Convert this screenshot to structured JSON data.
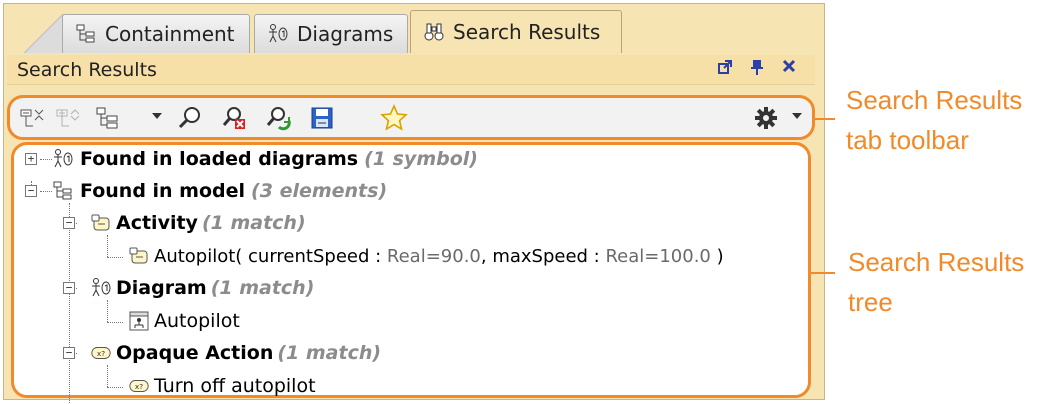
{
  "tabs": [
    {
      "label": "Containment",
      "icon": "containment-tree-icon"
    },
    {
      "label": "Diagrams",
      "icon": "diagrams-icon"
    },
    {
      "label": "Search Results",
      "icon": "binoculars-icon",
      "active": true
    }
  ],
  "panel": {
    "title": "Search Results",
    "controls": [
      "float-icon",
      "pin-icon",
      "close-icon"
    ]
  },
  "toolbar": {
    "buttons": [
      "collapse-all-icon",
      "expand-all-icon",
      "tree-layout-icon",
      "dropdown-arrow-icon",
      "find-icon",
      "clear-search-icon",
      "refresh-search-icon",
      "save-results-icon",
      "favorite-star-icon"
    ],
    "right": [
      "gear-icon",
      "dropdown-arrow-icon"
    ]
  },
  "tree": {
    "nodes": [
      {
        "label": "Found in loaded diagrams",
        "count": "(1 symbol)",
        "icon": "diagrams-icon",
        "expanded": false
      },
      {
        "label": "Found in model",
        "count": "(3 elements)",
        "icon": "containment-tree-icon",
        "expanded": true
      },
      {
        "label": "Activity",
        "count": "(1 match)",
        "icon": "activity-icon",
        "expanded": true
      },
      {
        "label": "Autopilot( currentSpeed : ",
        "val1": "Real=90.0",
        "mid": ", maxSpeed : ",
        "val2": "Real=100.0",
        "end": " )",
        "icon": "activity-icon"
      },
      {
        "label": "Diagram",
        "count": "(1 match)",
        "icon": "diagrams-icon",
        "expanded": true
      },
      {
        "label": "Autopilot",
        "icon": "activity-diagram-icon"
      },
      {
        "label": "Opaque Action",
        "count": "(1 match)",
        "icon": "opaque-action-icon",
        "expanded": true
      },
      {
        "label": "Turn off autopilot",
        "icon": "opaque-action-icon"
      }
    ]
  },
  "annotations": {
    "toolbar": [
      "Search Results",
      "tab toolbar"
    ],
    "tree": [
      "Search Results",
      "tree"
    ]
  },
  "colors": {
    "accent": "#f08a2a",
    "panel_bg": "#f7e4b3",
    "count_text": "#8c8c8c"
  }
}
